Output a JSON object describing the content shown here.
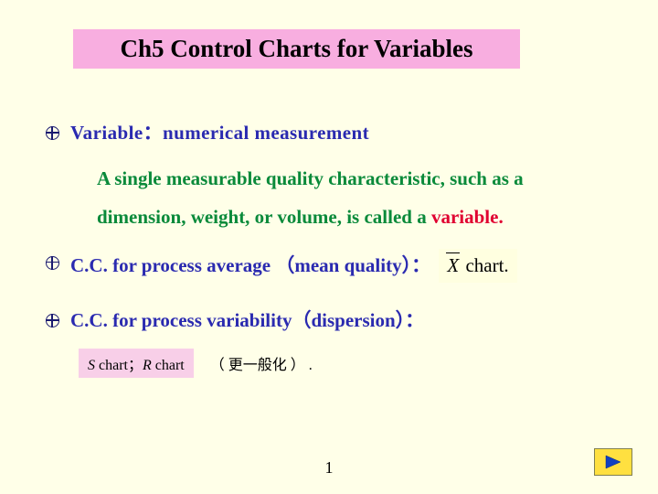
{
  "title": "Ch5  Control Charts for Variables",
  "bullets": {
    "b1_prefix": "Variable",
    "b1_colon": "：",
    "b1_rest": "numerical measurement",
    "sub_line1": "A single measurable quality characteristic, such as a",
    "sub_line2a": "dimension, weight, or volume, is  called a ",
    "sub_line2b": "variable.",
    "b2_text": "C.C. for process average （mean quality）：",
    "xbar_symbol": "X",
    "xbar_suffix": "   chart.",
    "b3_text": "C.C. for process variability（dispersion）：",
    "sr_s": "S",
    "sr_mid": " chart；",
    "sr_r": "R",
    "sr_end": " chart",
    "annot": "（ 更一般化 ）",
    "annot_dot": "."
  },
  "page_number": "1"
}
